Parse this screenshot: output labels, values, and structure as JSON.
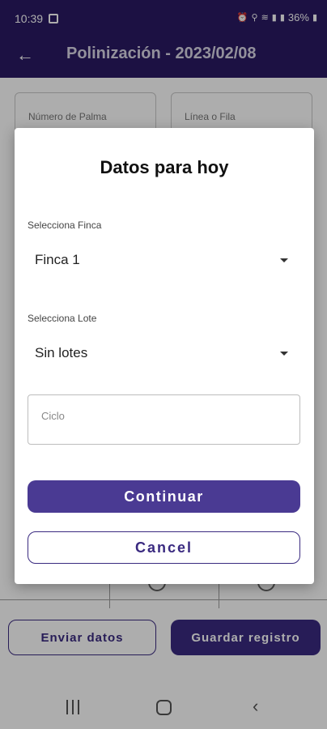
{
  "status_bar": {
    "time": "10:39",
    "battery": "36%",
    "icons": [
      "image-icon",
      "alarm-icon",
      "location-icon",
      "wifi-icon",
      "signal-icon",
      "signal-icon",
      "battery-icon"
    ]
  },
  "app_bar": {
    "title": "Polinización - 2023/02/08",
    "back_icon": "arrow-left-icon"
  },
  "form": {
    "palm_number_label": "Número de Palma",
    "row_label": "Línea o Fila",
    "send_button": "Enviar datos",
    "save_button": "Guardar registro"
  },
  "dialog": {
    "title": "Datos para hoy",
    "farm_label": "Selecciona Finca",
    "farm_value": "Finca 1",
    "lot_label": "Selecciona Lote",
    "lot_value": "Sin lotes",
    "cycle_placeholder": "Ciclo",
    "continue_button": "Continuar",
    "cancel_button": "Cancel"
  },
  "colors": {
    "primary": "#2a1a63",
    "button": "#4a3a93",
    "scrim": "rgba(0,0,0,0.32)"
  },
  "nav_bar": {
    "icons": [
      "recent-apps-icon",
      "home-icon",
      "back-icon"
    ]
  }
}
